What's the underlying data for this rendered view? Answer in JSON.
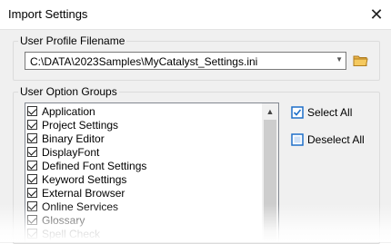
{
  "window": {
    "title": "Import Settings",
    "close_glyph": "✕"
  },
  "profile_group": {
    "label": "User Profile Filename",
    "filename": "C:\\DATA\\2023Samples\\MyCatalyst_Settings.ini",
    "dropdown_icon": "chevron-down-icon",
    "browse_icon": "folder-icon"
  },
  "options_group": {
    "label": "User Option Groups",
    "items": [
      {
        "label": "Application",
        "checked": true
      },
      {
        "label": "Project Settings",
        "checked": true
      },
      {
        "label": "Binary Editor",
        "checked": true
      },
      {
        "label": "DisplayFont",
        "checked": true
      },
      {
        "label": "Defined Font Settings",
        "checked": true
      },
      {
        "label": "Keyword Settings",
        "checked": true
      },
      {
        "label": "External Browser",
        "checked": true
      },
      {
        "label": "Online Services",
        "checked": true
      },
      {
        "label": "Glossary",
        "checked": true
      },
      {
        "label": "Spell Check",
        "checked": true
      }
    ],
    "select_all_label": "Select All",
    "deselect_all_label": "Deselect All"
  },
  "colors": {
    "dialog_background": "#f0f0f0",
    "title_background": "#ffffff",
    "icon_blue": "#1e6fc9",
    "folder_yellow": "#e8b24a"
  }
}
